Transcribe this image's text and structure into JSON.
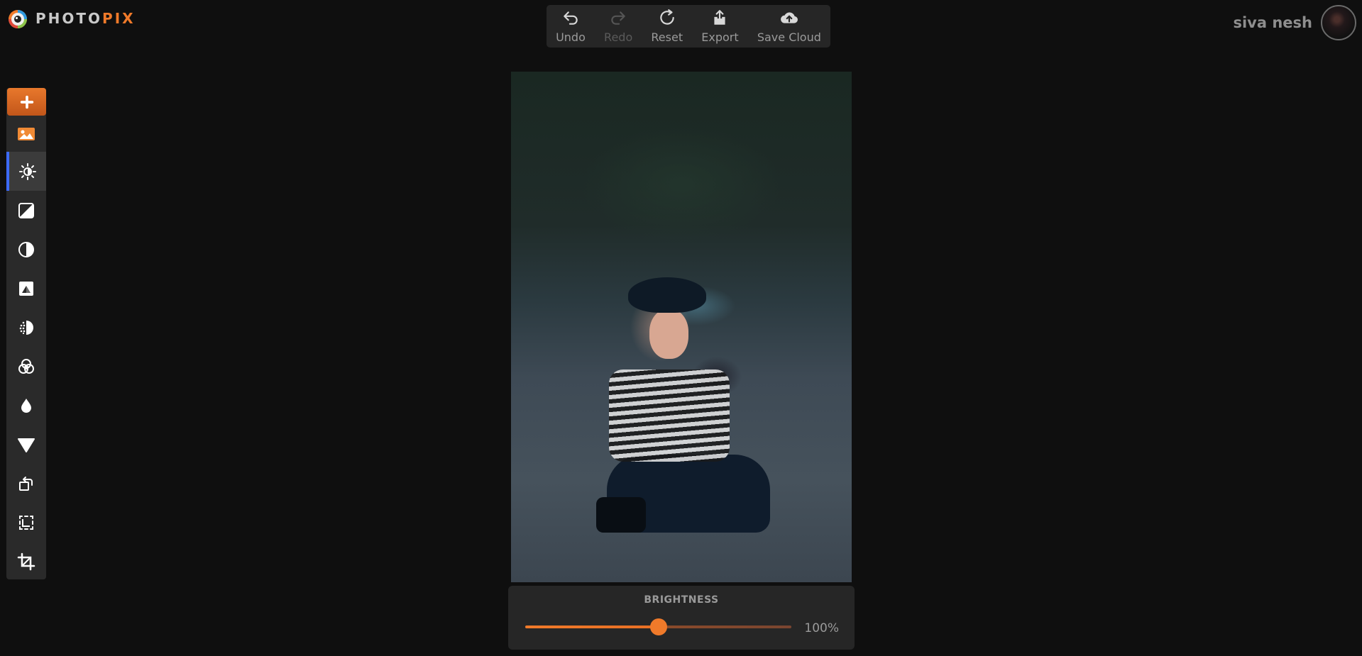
{
  "app": {
    "logo_part1": "PHOTO",
    "logo_part2": "PIX",
    "accent": "#f07a2a",
    "active_marker": "#3d6bff"
  },
  "toolbar": {
    "undo": "Undo",
    "redo": "Redo",
    "reset": "Reset",
    "export": "Export",
    "save_cloud": "Save Cloud"
  },
  "user": {
    "name": "siva nesh"
  },
  "sidebar": {
    "items": [
      {
        "name": "add",
        "icon": "plus-icon"
      },
      {
        "name": "photos",
        "icon": "image-icon"
      },
      {
        "name": "brightness",
        "icon": "sun-icon",
        "active": true
      },
      {
        "name": "contrast",
        "icon": "contrast-square-icon"
      },
      {
        "name": "saturation",
        "icon": "half-circle-icon"
      },
      {
        "name": "exposure",
        "icon": "exposure-icon"
      },
      {
        "name": "vignette",
        "icon": "dotted-half-circle-icon"
      },
      {
        "name": "color-channels",
        "icon": "overlapping-circles-icon"
      },
      {
        "name": "tint",
        "icon": "drop-icon"
      },
      {
        "name": "filter",
        "icon": "triangle-icon"
      },
      {
        "name": "rotate",
        "icon": "rotate-icon"
      },
      {
        "name": "frame",
        "icon": "frame-icon"
      },
      {
        "name": "crop",
        "icon": "crop-icon"
      }
    ]
  },
  "adjustment": {
    "title": "BRIGHTNESS",
    "value_label": "100%",
    "slider_fraction": 0.5
  }
}
